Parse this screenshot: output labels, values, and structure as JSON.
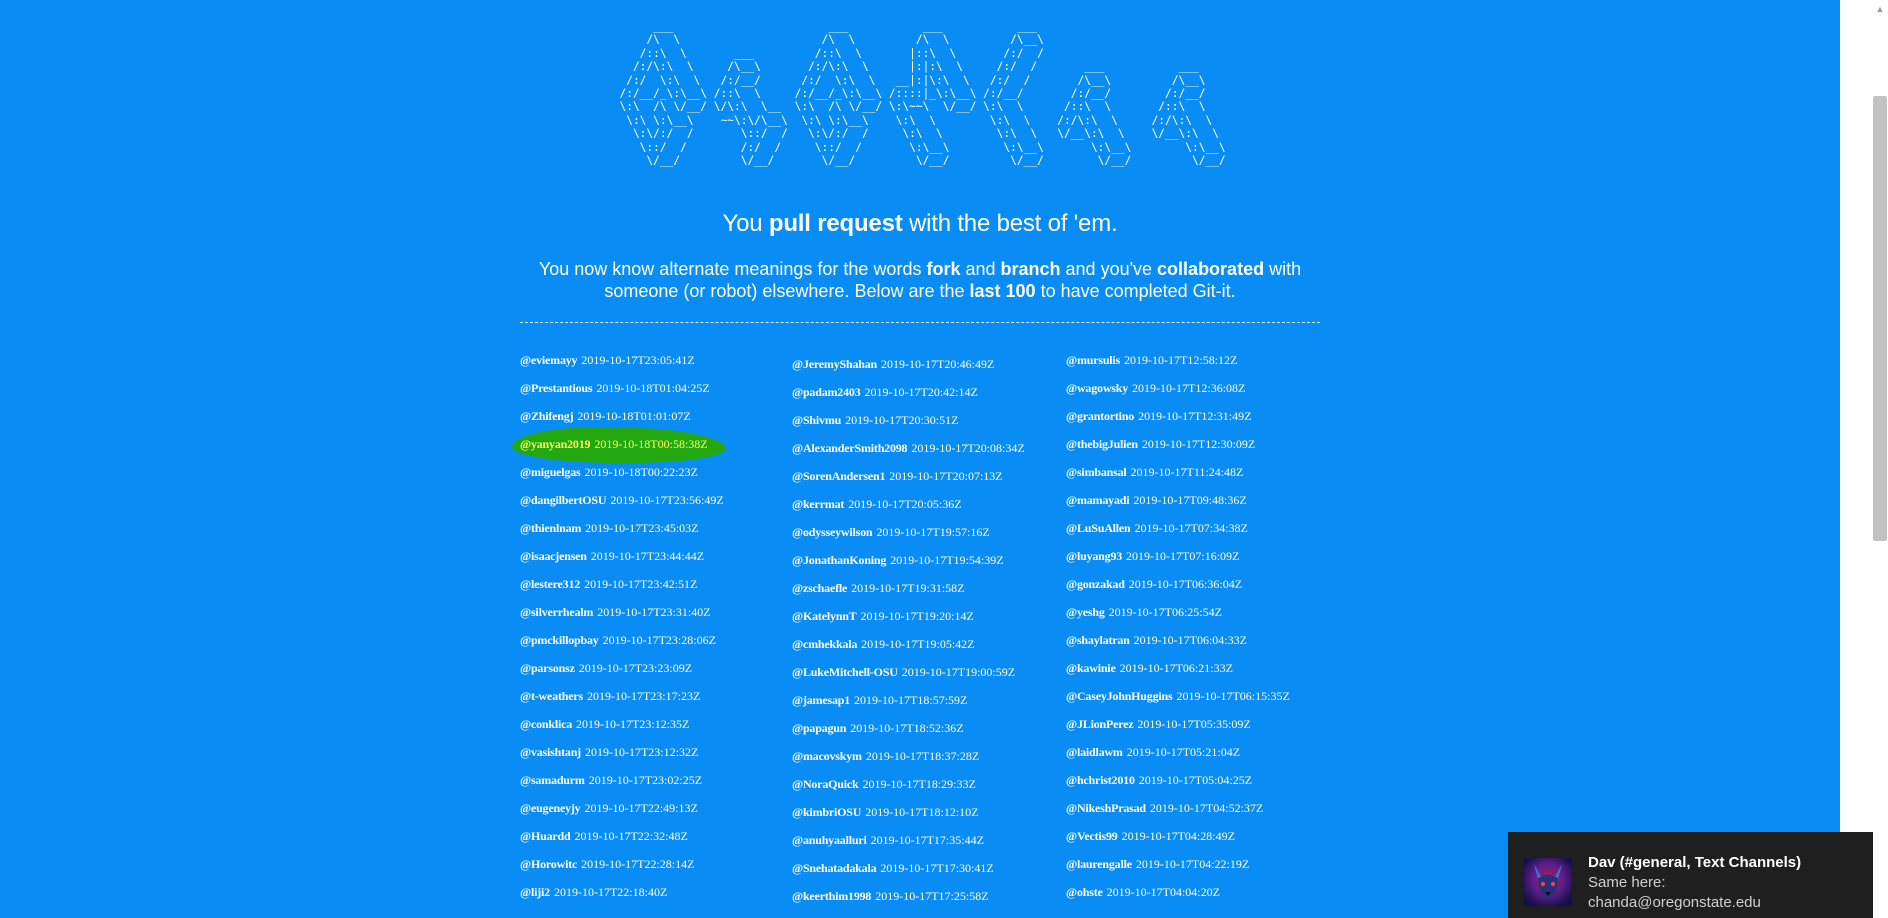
{
  "ascii_art": "       ___                       ___           ___           ___\n      /\\  \\                     /\\  \\         /\\  \\         /\\__\\\n     /::\\  \\       ___         /::\\  \\       |::\\  \\       /:/  /\n    /:/\\:\\  \\     /\\__\\       /:/\\:\\  \\      |:|:\\  \\     /:/  /       ___           ___\n   /:/  \\:\\  \\   /:/__/      /:/  \\:\\  \\   __|:|\\:\\  \\   /:/  /       /\\__\\         /\\__\\\n  /:/__/_\\:\\__\\ /::\\  \\     /:/__/_\\:\\__\\ /::::|_\\:\\__\\ /:/__/       /:/__/        /:/__/\n  \\:\\  /\\ \\/__/ \\/\\:\\  \\__  \\:\\  /\\ \\/__/ \\:\\~~\\  \\/__/ \\:\\  \\      /::\\  \\       /::\\  \\\n   \\:\\ \\:\\__\\    ~~\\:\\/\\__\\  \\:\\ \\:\\__\\    \\:\\  \\        \\:\\  \\    /:/\\:\\  \\     /:/\\:\\  \\\n    \\:\\/:/  /       \\::/  /   \\:\\/:/  /     \\:\\  \\        \\:\\  \\   \\/__\\:\\  \\    \\/__\\:\\  \\\n     \\::/  /        /:/  /     \\::/  /       \\:\\__\\        \\:\\__\\       \\:\\__\\        \\:\\__\\\n      \\/__/         \\/__/       \\/__/         \\/__/         \\/__/        \\/__/         \\/__/",
  "tagline": {
    "pre": "You ",
    "bold": "pull request",
    "post": " with the best of 'em."
  },
  "description": {
    "p1": "You now know alternate meanings for the words ",
    "b1": "fork",
    "p2": " and ",
    "b2": "branch",
    "p3": " and you've ",
    "b3": "collaborated",
    "p4": " with someone (or robot) elsewhere. Below are the ",
    "b4": "last 100",
    "p5": " to have completed Git-it."
  },
  "columns": [
    [
      {
        "user": "@eviemayy",
        "ts": "2019-10-17T23:05:41Z"
      },
      {
        "user": "@Prestantious",
        "ts": "2019-10-18T01:04:25Z"
      },
      {
        "user": "@Zhifengj",
        "ts": "2019-10-18T01:01:07Z"
      },
      {
        "user": "@yanyan2019",
        "ts": "2019-10-18T00:58:38Z"
      },
      {
        "user": "@miguelgas",
        "ts": "2019-10-18T00:22:23Z"
      },
      {
        "user": "@dangilbertOSU",
        "ts": "2019-10-17T23:56:49Z"
      },
      {
        "user": "@thienlnam",
        "ts": "2019-10-17T23:45:03Z"
      },
      {
        "user": "@isaacjensen",
        "ts": "2019-10-17T23:44:44Z"
      },
      {
        "user": "@lestere312",
        "ts": "2019-10-17T23:42:51Z"
      },
      {
        "user": "@silverrhealm",
        "ts": "2019-10-17T23:31:40Z"
      },
      {
        "user": "@pmckillopbay",
        "ts": "2019-10-17T23:28:06Z"
      },
      {
        "user": "@parsonsz",
        "ts": "2019-10-17T23:23:09Z"
      },
      {
        "user": "@t-weathers",
        "ts": "2019-10-17T23:17:23Z"
      },
      {
        "user": "@conklica",
        "ts": "2019-10-17T23:12:35Z"
      },
      {
        "user": "@vasishtanj",
        "ts": "2019-10-17T23:12:32Z"
      },
      {
        "user": "@samadurm",
        "ts": "2019-10-17T23:02:25Z"
      },
      {
        "user": "@eugeneyjy",
        "ts": "2019-10-17T22:49:13Z"
      },
      {
        "user": "@Huardd",
        "ts": "2019-10-17T22:32:48Z"
      },
      {
        "user": "@Horowitc",
        "ts": "2019-10-17T22:28:14Z"
      },
      {
        "user": "@liji2",
        "ts": "2019-10-17T22:18:40Z"
      }
    ],
    [
      {
        "user": "@JeremyShahan",
        "ts": "2019-10-17T20:46:49Z"
      },
      {
        "user": "@padam2403",
        "ts": "2019-10-17T20:42:14Z"
      },
      {
        "user": "@Shivmu",
        "ts": "2019-10-17T20:30:51Z"
      },
      {
        "user": "@AlexanderSmith2098",
        "ts": "2019-10-17T20:08:34Z"
      },
      {
        "user": "@SorenAndersen1",
        "ts": "2019-10-17T20:07:13Z"
      },
      {
        "user": "@kerrmat",
        "ts": "2019-10-17T20:05:36Z"
      },
      {
        "user": "@odysseywilson",
        "ts": "2019-10-17T19:57:16Z"
      },
      {
        "user": "@JonathanKoning",
        "ts": "2019-10-17T19:54:39Z"
      },
      {
        "user": "@zschaefle",
        "ts": "2019-10-17T19:31:58Z"
      },
      {
        "user": "@KatelynnT",
        "ts": "2019-10-17T19:20:14Z"
      },
      {
        "user": "@cmhekkala",
        "ts": "2019-10-17T19:05:42Z"
      },
      {
        "user": "@LukeMitchell-OSU",
        "ts": "2019-10-17T19:00:59Z"
      },
      {
        "user": "@jamesap1",
        "ts": "2019-10-17T18:57:59Z"
      },
      {
        "user": "@papagun",
        "ts": "2019-10-17T18:52:36Z"
      },
      {
        "user": "@macovskym",
        "ts": "2019-10-17T18:37:28Z"
      },
      {
        "user": "@NoraQuick",
        "ts": "2019-10-17T18:29:33Z"
      },
      {
        "user": "@kimbriOSU",
        "ts": "2019-10-17T18:12:10Z"
      },
      {
        "user": "@anuhyaalluri",
        "ts": "2019-10-17T17:35:44Z"
      },
      {
        "user": "@Snehatadakala",
        "ts": "2019-10-17T17:30:41Z"
      },
      {
        "user": "@keerthim1998",
        "ts": "2019-10-17T17:25:58Z"
      }
    ],
    [
      {
        "user": "@mursulis",
        "ts": "2019-10-17T12:58:12Z"
      },
      {
        "user": "@wagowsky",
        "ts": "2019-10-17T12:36:08Z"
      },
      {
        "user": "@grantortino",
        "ts": "2019-10-17T12:31:49Z"
      },
      {
        "user": "@thebigJulien",
        "ts": "2019-10-17T12:30:09Z"
      },
      {
        "user": "@simbansal",
        "ts": "2019-10-17T11:24:48Z"
      },
      {
        "user": "@mamayadi",
        "ts": "2019-10-17T09:48:36Z"
      },
      {
        "user": "@LuSuAllen",
        "ts": "2019-10-17T07:34:38Z"
      },
      {
        "user": "@luyang93",
        "ts": "2019-10-17T07:16:09Z"
      },
      {
        "user": "@gonzakad",
        "ts": "2019-10-17T06:36:04Z"
      },
      {
        "user": "@yeshg",
        "ts": "2019-10-17T06:25:54Z"
      },
      {
        "user": "@shaylatran",
        "ts": "2019-10-17T06:04:33Z"
      },
      {
        "user": "@kawinie",
        "ts": "2019-10-17T06:21:33Z"
      },
      {
        "user": "@CaseyJohnHuggins",
        "ts": "2019-10-17T06:15:35Z"
      },
      {
        "user": "@JLionPerez",
        "ts": "2019-10-17T05:35:09Z"
      },
      {
        "user": "@laidlawm",
        "ts": "2019-10-17T05:21:04Z"
      },
      {
        "user": "@hchrist2010",
        "ts": "2019-10-17T05:04:25Z"
      },
      {
        "user": "@NikeshPrasad",
        "ts": "2019-10-17T04:52:37Z"
      },
      {
        "user": "@Vectis99",
        "ts": "2019-10-17T04:28:49Z"
      },
      {
        "user": "@laurengalle",
        "ts": "2019-10-17T04:22:19Z"
      },
      {
        "user": "@ohste",
        "ts": "2019-10-17T04:04:20Z"
      }
    ]
  ],
  "highlighted_user": "@yanyan2019",
  "toast": {
    "title": "Dav (#general, Text Channels)",
    "line1": "Same here:",
    "line2": "chanda@oregonstate.edu",
    "avatar_icon": "wolf-avatar-icon"
  },
  "colors": {
    "background": "#0a8cf5",
    "highlight_fill": "#23a812",
    "highlight_text": "#ffff5a",
    "toast_bg": "#1f1f1f"
  }
}
